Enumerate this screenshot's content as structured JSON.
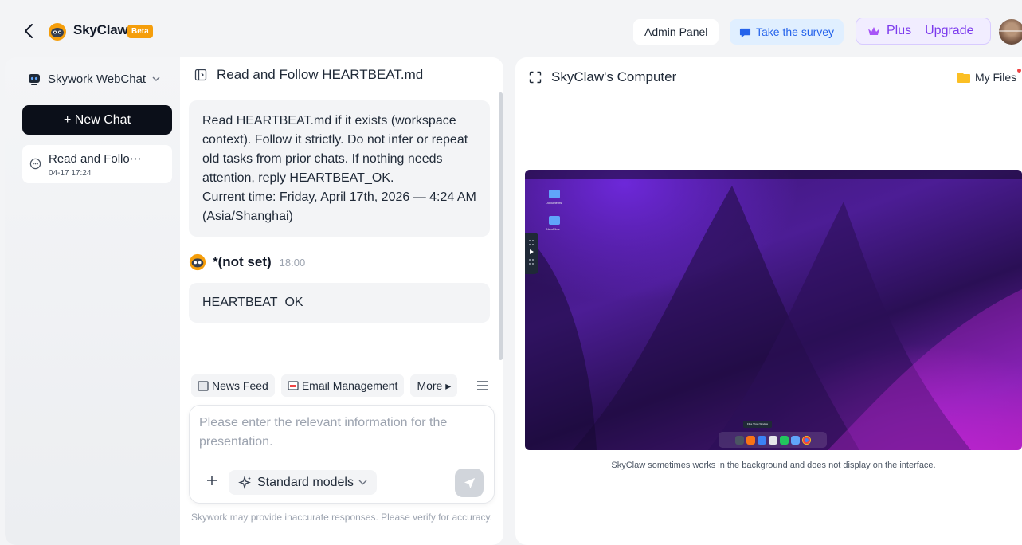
{
  "header": {
    "app_name": "SkyClaw",
    "beta_label": "Beta",
    "admin_panel": "Admin Panel",
    "survey": "Take the survey",
    "plus": "Plus",
    "upgrade": "Upgrade"
  },
  "sidebar": {
    "workspace": "Skywork WebChat",
    "new_chat": "+ New Chat",
    "chats": [
      {
        "title": "Read and Follo⋯",
        "time": "04-17 17:24"
      }
    ]
  },
  "chat": {
    "title": "Read and Follow HEARTBEAT.md",
    "user_message_lines": [
      "Read HEARTBEAT.md if it exists (workspace",
      "context). Follow it strictly. Do not infer or repeat",
      "old tasks from prior chats. If nothing needs",
      "attention, reply HEARTBEAT_OK.",
      "Current time: Friday, April 17th, 2026 — 4:24 AM",
      "(Asia/Shanghai)"
    ],
    "bot_name": "*(not set)",
    "bot_time": "18:00",
    "bot_message": "HEARTBEAT_OK",
    "shortcuts": [
      "News Feed",
      "Email Management",
      "More ▸"
    ],
    "input_placeholder": "Please enter the relevant information for the presentation.",
    "model": "Standard models",
    "disclaimer": "Skywork may provide inaccurate responses. Please verify for accuracy."
  },
  "computer": {
    "title": "SkyClaw's Computer",
    "my_files": "My Files",
    "note": "SkyClaw sometimes works in the background and does not display on the interface.",
    "desktop_icons": [
      "Documents",
      "NewFiles"
    ],
    "dock_tooltip": "Files Show Window"
  },
  "colors": {
    "accent_dark": "#0b0f19",
    "survey_blue": "#2563eb",
    "plus_purple": "#7c3aed",
    "beta_orange": "#f59e0b"
  }
}
